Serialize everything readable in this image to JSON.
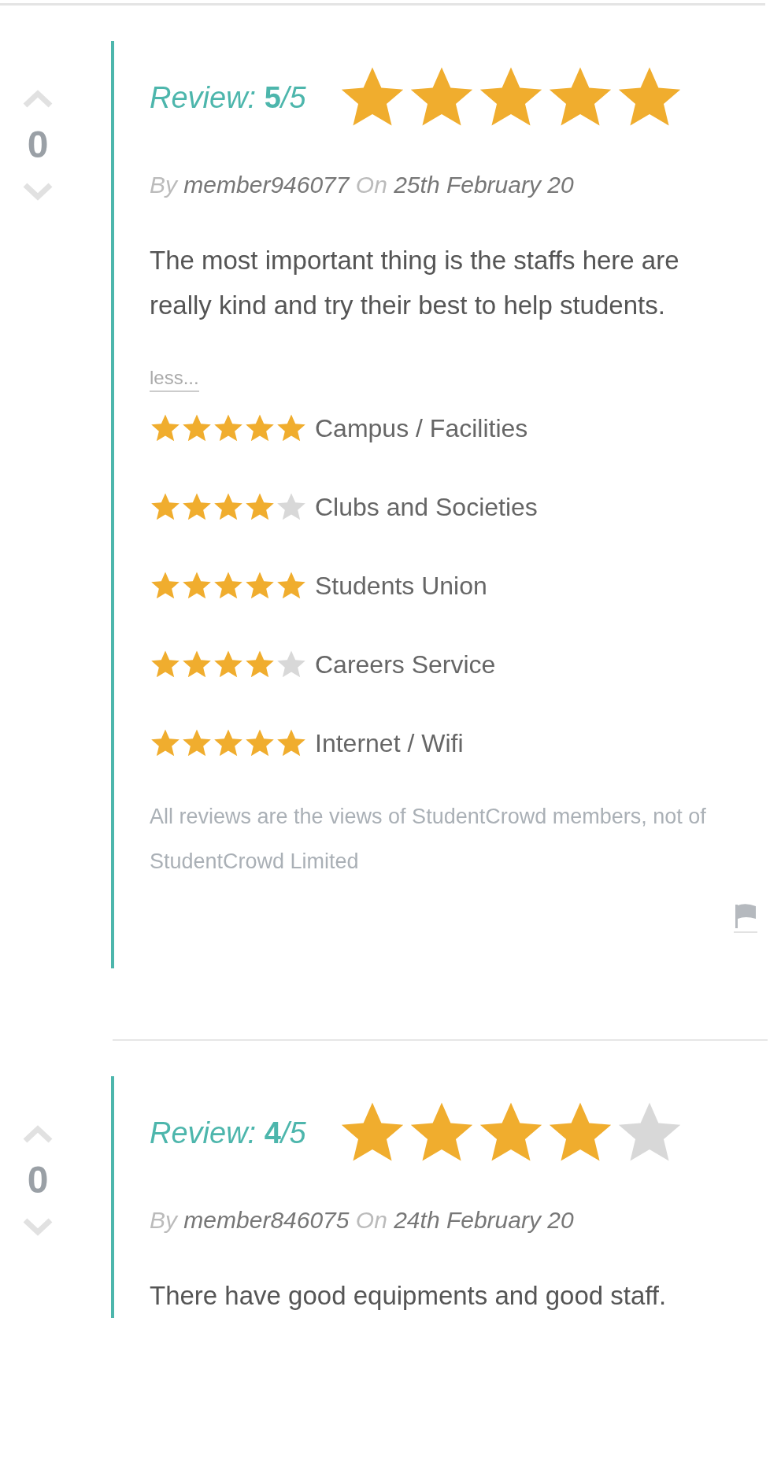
{
  "reviews": [
    {
      "votes": "0",
      "label": "Review:",
      "score": "5",
      "out_of": "/5",
      "stars": 5,
      "by_label": "By",
      "author": "member946077",
      "on_label": "On",
      "date": "25th February 20",
      "body": "The most important thing is the staffs here are really kind and try their best to help students.",
      "less_link": "less...",
      "sub_ratings": [
        {
          "name": "Campus / Facilities",
          "stars": 5
        },
        {
          "name": "Clubs and Societies",
          "stars": 4
        },
        {
          "name": "Students Union",
          "stars": 5
        },
        {
          "name": "Careers Service",
          "stars": 4
        },
        {
          "name": "Internet / Wifi",
          "stars": 5
        }
      ],
      "disclaimer": "All reviews are the views of StudentCrowd members, not of StudentCrowd Limited",
      "flag": true
    },
    {
      "votes": "0",
      "label": "Review:",
      "score": "4",
      "out_of": "/5",
      "stars": 4,
      "by_label": "By",
      "author": "member846075",
      "on_label": "On",
      "date": "24th February 20",
      "body": "There have good equipments and good staff."
    }
  ]
}
